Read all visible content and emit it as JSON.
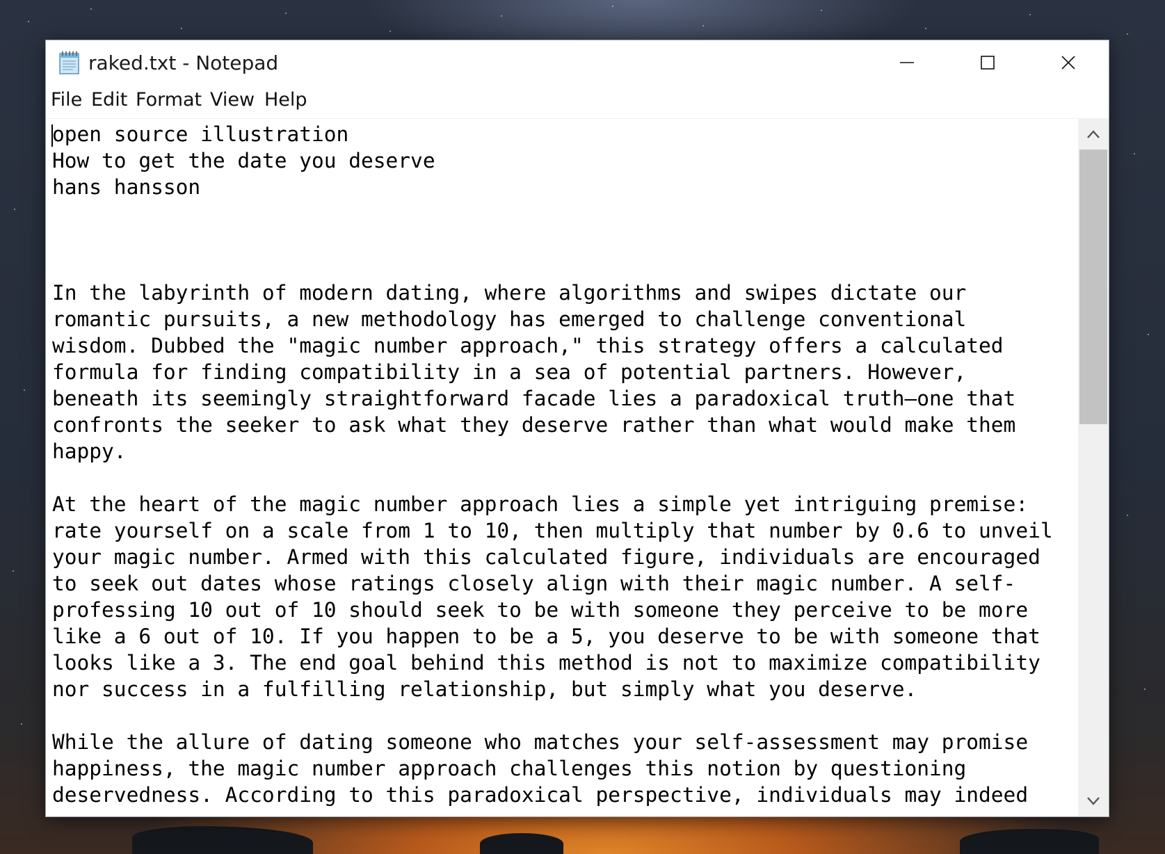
{
  "window": {
    "title": "raked.txt - Notepad",
    "app_icon": "notepad-icon"
  },
  "controls": {
    "minimize_icon": "minimize-icon",
    "maximize_icon": "maximize-icon",
    "close_icon": "close-icon"
  },
  "menu": {
    "file": "File",
    "edit": "Edit",
    "format": "Format",
    "view": "View",
    "help": "Help"
  },
  "editor": {
    "lines": [
      "open source illustration",
      "How to get the date you deserve",
      "hans hansson",
      "",
      "",
      "",
      "In the labyrinth of modern dating, where algorithms and swipes dictate our",
      "romantic pursuits, a new methodology has emerged to challenge conventional",
      "wisdom. Dubbed the \"magic number approach,\" this strategy offers a calculated",
      "formula for finding compatibility in a sea of potential partners. However,",
      "beneath its seemingly straightforward facade lies a paradoxical truth—one that",
      "confronts the seeker to ask what they deserve rather than what would make them",
      "happy.",
      "",
      "At the heart of the magic number approach lies a simple yet intriguing premise:",
      "rate yourself on a scale from 1 to 10, then multiply that number by 0.6 to unveil",
      "your magic number. Armed with this calculated figure, individuals are encouraged",
      "to seek out dates whose ratings closely align with their magic number. A self-",
      "professing 10 out of 10 should seek to be with someone they perceive to be more",
      "like a 6 out of 10. If you happen to be a 5, you deserve to be with someone that",
      "looks like a 3. The end goal behind this method is not to maximize compatibility",
      "nor success in a fulfilling relationship, but simply what you deserve.",
      "",
      "While the allure of dating someone who matches your self-assessment may promise",
      "happiness, the magic number approach challenges this notion by questioning",
      "deservedness. According to this paradoxical perspective, individuals may indeed"
    ]
  },
  "scrollbar": {
    "up_icon": "chevron-up-icon",
    "down_icon": "chevron-down-icon",
    "scroll_position": 0
  }
}
